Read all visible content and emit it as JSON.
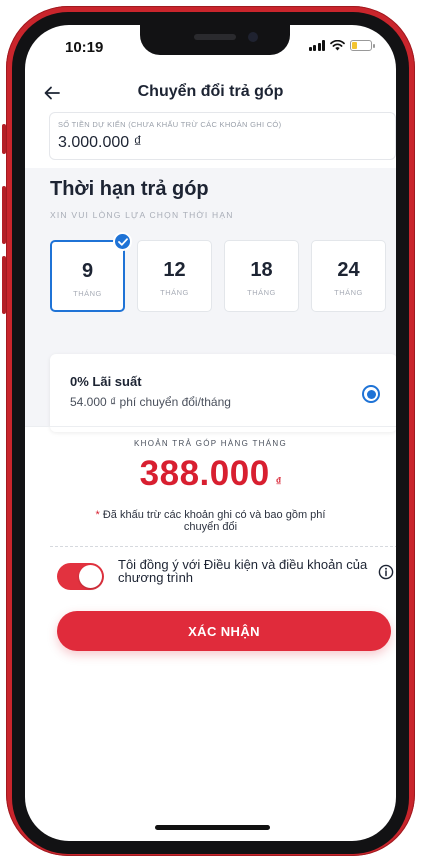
{
  "status_bar": {
    "time": "10:19"
  },
  "header": {
    "title": "Chuyển đổi trả góp"
  },
  "amount": {
    "label": "SỐ TIỀN DỰ KIẾN (CHƯA KHẤU TRỪ CÁC KHOẢN GHI CÓ)",
    "value": "3.000.000 ₫"
  },
  "term": {
    "title": "Thời hạn trả góp",
    "subtitle": "XIN VUI LÒNG LỰA CHỌN THỜI HẠN",
    "selected_index": 0,
    "options": [
      {
        "value": "9",
        "unit": "THÁNG"
      },
      {
        "value": "12",
        "unit": "THÁNG"
      },
      {
        "value": "18",
        "unit": "THÁNG"
      },
      {
        "value": "24",
        "unit": "THÁNG"
      }
    ]
  },
  "rate_card": {
    "title": "0% Lãi suất",
    "description": "54.000 ₫ phí chuyển đổi/tháng",
    "selected": true
  },
  "monthly": {
    "label": "KHOẢN TRẢ GÓP HÀNG THÁNG",
    "amount": "388.000",
    "currency": "₫",
    "note_star": "*",
    "note": "Đã khấu trừ các khoản ghi có và bao gồm phí chuyển đổi"
  },
  "agreement": {
    "text": "Tôi đồng ý với Điều kiện và điều khoản của chương trình",
    "checked": true
  },
  "confirm_button": {
    "label": "XÁC NHẬN"
  },
  "colors": {
    "brand_red": "#e02b3b",
    "accent_blue": "#1f73d6",
    "phone_frame": "#c9252c"
  },
  "icons": {
    "back": "arrow-left-icon",
    "check": "check-icon",
    "info": "info-icon",
    "wifi": "wifi-icon",
    "signal": "signal-icon",
    "battery": "battery-icon"
  }
}
